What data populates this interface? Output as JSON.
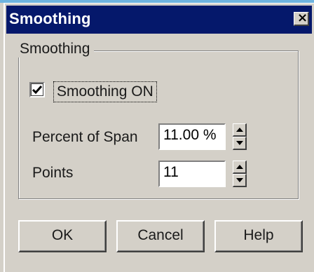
{
  "window": {
    "title": "Smoothing",
    "close_symbol": "×"
  },
  "group": {
    "label": "Smoothing"
  },
  "smoothing_checkbox": {
    "label": "Smoothing ON",
    "checked": true
  },
  "percent": {
    "label": "Percent of Span",
    "value": "11.00 %"
  },
  "points": {
    "label": "Points",
    "value": "11"
  },
  "buttons": {
    "ok": "OK",
    "cancel": "Cancel",
    "help": "Help"
  }
}
